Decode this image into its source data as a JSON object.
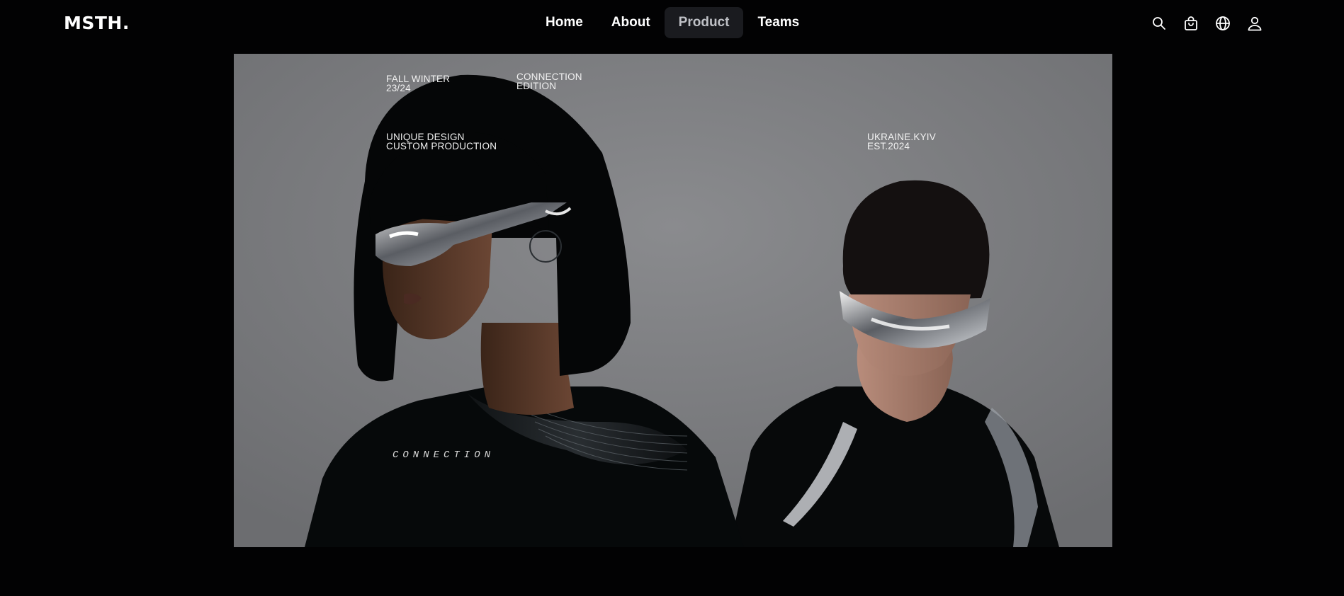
{
  "header": {
    "logo": "MSTH.",
    "nav": [
      {
        "label": "Home",
        "active": false
      },
      {
        "label": "About",
        "active": false
      },
      {
        "label": "Product",
        "active": true
      },
      {
        "label": "Teams",
        "active": false
      }
    ],
    "icons": [
      "search-icon",
      "cart-icon",
      "globe-icon",
      "user-icon"
    ]
  },
  "hero": {
    "overlay": {
      "season": [
        "FALL WINTER",
        "23/24"
      ],
      "edition": [
        "CONNECTION",
        "EDITION"
      ],
      "design": [
        "UNIQUE DESIGN",
        "CUSTOM PRODUCTION"
      ],
      "location": [
        "UKRAINE.KYIV",
        "EST.2024"
      ]
    },
    "shirt_print": "CONNECTION"
  },
  "colors": {
    "background": "#020203",
    "active_nav_bg": "#1a1b1f",
    "active_nav_text": "#bfc1c6",
    "photo_backdrop": "#76777a"
  }
}
